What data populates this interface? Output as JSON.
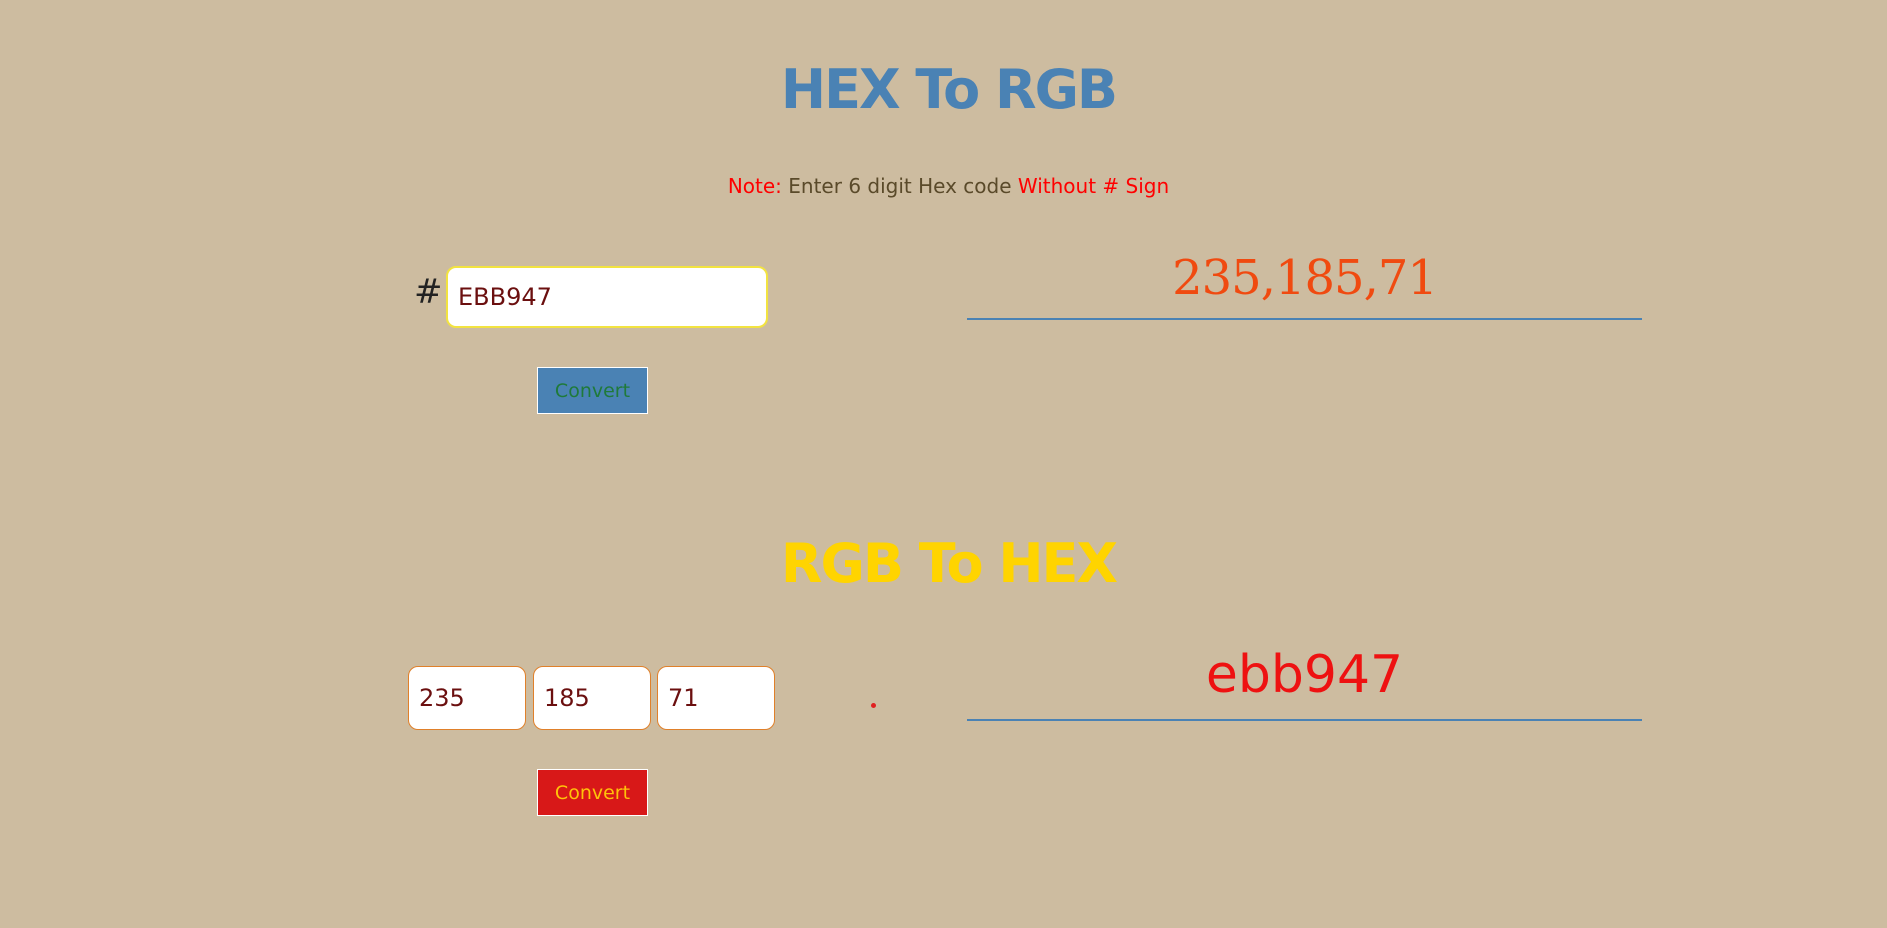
{
  "hex_to_rgb": {
    "title": "HEX To RGB",
    "note_label": "Note:",
    "note_text": "Enter 6 digit Hex code",
    "note_emphasis": "Without # Sign",
    "hash_symbol": "#",
    "hex_input_value": "EBB947",
    "convert_label": "Convert",
    "result": "235,185,71"
  },
  "rgb_to_hex": {
    "title": "RGB To HEX",
    "r_value": "235",
    "g_value": "185",
    "b_value": "71",
    "convert_label": "Convert",
    "result": "ebb947"
  },
  "colors": {
    "background": "#cdbca0",
    "hex_title": "#4a82b4",
    "rgb_title": "#ffd400",
    "hex_button_bg": "#4a82b4",
    "rgb_button_bg": "#d81818",
    "rgb_result_text": "#f04a10",
    "hex_result_text": "#ee1111",
    "note_red": "#ff0000"
  }
}
